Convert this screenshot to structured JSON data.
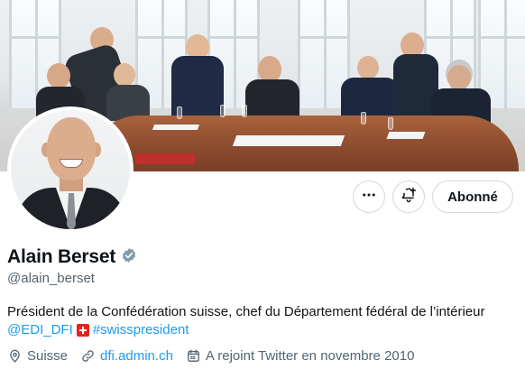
{
  "profile": {
    "name": "Alain Berset",
    "handle": "@alain_berset",
    "verified": true,
    "bio_text": "Président de la Confédération suisse, chef du Département fédéral de l’intérieur",
    "bio_mention": "@EDI_DFI",
    "bio_flag": "swiss-flag-emoji",
    "bio_hashtag": "#swisspresident",
    "location": "Suisse",
    "website": "dfi.admin.ch",
    "joined": "A rejoint Twitter en novembre 2010"
  },
  "actions": {
    "follow_label": "Abonné",
    "more_icon": "more-horizontal-icon",
    "notify_icon": "bell-plus-icon"
  },
  "colors": {
    "link": "#1d9bf0",
    "verified_badge": "#829aab",
    "secondary_text": "#536471",
    "border": "#cfd9de"
  }
}
